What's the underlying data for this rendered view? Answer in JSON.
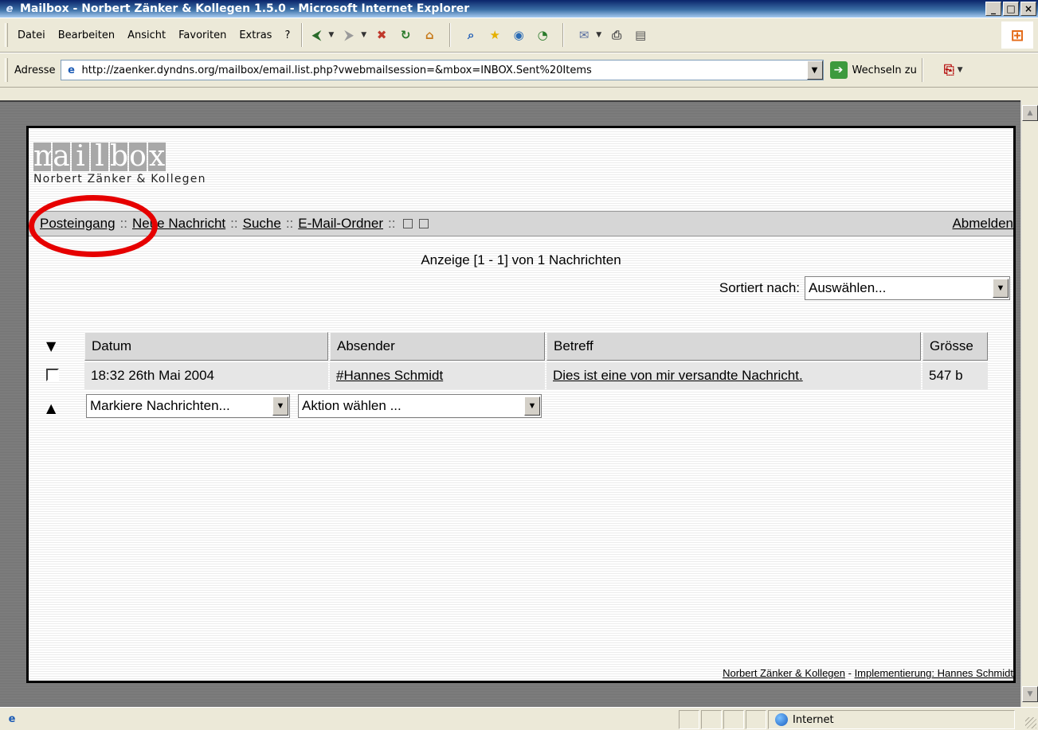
{
  "window": {
    "title": "Mailbox - Norbert Zänker & Kollegen 1.5.0 - Microsoft Internet Explorer",
    "minimize": "_",
    "maximize": "□",
    "close": "×"
  },
  "menu": {
    "items": [
      "Datei",
      "Bearbeiten",
      "Ansicht",
      "Favoriten",
      "Extras",
      "?"
    ]
  },
  "toolbar": {
    "icons": [
      "back-icon",
      "forward-icon",
      "stop-icon",
      "refresh-icon",
      "home-icon",
      "search-icon",
      "favorites-icon",
      "media-icon",
      "history-icon",
      "mail-icon",
      "print-icon",
      "edit-icon"
    ]
  },
  "address": {
    "label": "Adresse",
    "url": "http://zaenker.dyndns.org/mailbox/email.list.php?vwebmailsession=&mbox=INBOX.Sent%20Items",
    "go_label": "Wechseln zu"
  },
  "logo": {
    "letters": [
      "m",
      "a",
      "i",
      "l",
      "b",
      "o",
      "x"
    ],
    "subtitle": "Norbert Zänker & Kollegen"
  },
  "nav": {
    "inbox": "Posteingang",
    "new_message": "Neue Nachricht",
    "search": "Suche ",
    "folders": "E-Mail-Ordner",
    "sep": "::",
    "logout": "Abmelden"
  },
  "list": {
    "info": "Anzeige [1 - 1] von 1 Nachrichten",
    "sort_label": "Sortiert nach:",
    "sort_value": "Auswählen...",
    "columns": [
      "Datum",
      "Absender",
      "Betreff",
      "Grösse"
    ],
    "sort_desc_glyph": "▼",
    "sort_asc_glyph": "▲",
    "rows": [
      {
        "date": "18:32 26th Mai 2004",
        "sender": "#Hannes Schmidt",
        "subject": "Dies ist eine von mir versandte Nachricht.",
        "size": "547 b"
      }
    ],
    "mark_select": "Markiere Nachrichten...",
    "action_select": "Aktion wählen ..."
  },
  "footer": {
    "company": "Norbert Zänker & Kollegen",
    "dash": " - ",
    "impl": "Implementierung: Hannes Schmidt"
  },
  "status": {
    "zone": "Internet"
  }
}
